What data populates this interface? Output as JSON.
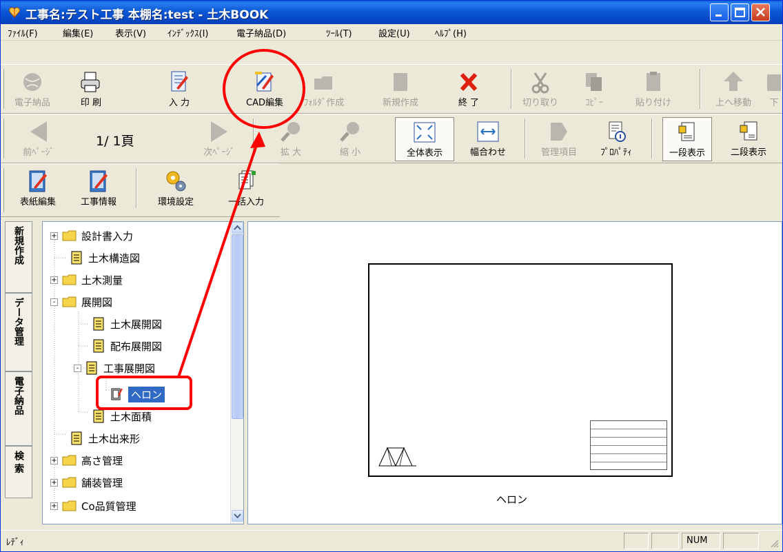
{
  "window": {
    "title": "工事名:テスト工事  本棚名:test  - 土木BOOK"
  },
  "menu": [
    "ﾌｧｲﾙ(F)",
    "編集(E)",
    "表示(V)",
    "ｲﾝﾃﾞｯｸｽ(I)",
    "電子納品(D)",
    "ﾂｰﾙ(T)",
    "設定(U)",
    "ﾍﾙﾌﾟ(H)"
  ],
  "toolbar1": [
    {
      "label": "電子納品",
      "icon": "globe-icon",
      "enabled": false
    },
    {
      "label": "印 刷",
      "icon": "printer-icon",
      "enabled": true
    },
    {
      "label": "入 力",
      "icon": "input-icon",
      "enabled": true
    },
    {
      "label": "CAD編集",
      "icon": "cad-edit-icon",
      "enabled": true
    },
    {
      "label": "ﾌｫﾙﾀﾞ作成",
      "icon": "folder-create-icon",
      "enabled": false
    },
    {
      "label": "新規作成",
      "icon": "new-doc-icon",
      "enabled": false
    },
    {
      "label": "終 了",
      "icon": "close-x-icon",
      "enabled": true
    },
    {
      "label": "切り取り",
      "icon": "scissors-icon",
      "enabled": false
    },
    {
      "label": "ｺﾋﾟｰ",
      "icon": "copy-icon",
      "enabled": false
    },
    {
      "label": "貼り付け",
      "icon": "paste-icon",
      "enabled": false
    },
    {
      "label": "上へ移動",
      "icon": "up-arrow-icon",
      "enabled": false
    },
    {
      "label": "下",
      "icon": "down-arrow-icon",
      "enabled": false
    }
  ],
  "toolbar2": {
    "prev": "前ﾍﾟｰｼﾞ",
    "page": "1/  1頁",
    "next": "次ﾍﾟｰｼﾞ",
    "zoom_in": "拡 大",
    "zoom_out": "縮 小",
    "fit_all": "全体表示",
    "fit_width": "幅合わせ",
    "manage": "管理項目",
    "properties": "ﾌﾟﾛﾊﾟﾃｨ",
    "one_col": "一段表示",
    "two_col": "二段表示"
  },
  "toolbar3": {
    "cover_edit": "表紙編集",
    "project_info": "工事情報",
    "env_settings": "環境設定",
    "batch_input": "一括入力"
  },
  "side_tabs": [
    "新規作成",
    "データ管理",
    "電子納品",
    "検 索"
  ],
  "tree": {
    "items": [
      {
        "label": "設計書入力",
        "type": "folder",
        "expander": "+"
      },
      {
        "label": "土木構造図",
        "type": "doc"
      },
      {
        "label": "土木測量",
        "type": "folder",
        "expander": "+"
      },
      {
        "label": "展開図",
        "type": "folder",
        "expander": "-"
      },
      {
        "label": "土木展開図",
        "type": "doc"
      },
      {
        "label": "配布展開図",
        "type": "doc"
      },
      {
        "label": "工事展開図",
        "type": "doc",
        "expander": "-"
      },
      {
        "label": "ヘロン",
        "type": "cad",
        "selected": true
      },
      {
        "label": "土木面積",
        "type": "doc"
      },
      {
        "label": "土木出来形",
        "type": "doc"
      },
      {
        "label": "高さ管理",
        "type": "folder",
        "expander": "+"
      },
      {
        "label": "舗装管理",
        "type": "folder",
        "expander": "+"
      },
      {
        "label": "Co品質管理",
        "type": "folder",
        "expander": "+"
      }
    ]
  },
  "preview": {
    "caption": "ヘロン"
  },
  "status": {
    "text": "ﾚﾃﾞｨ",
    "num": "NUM"
  },
  "colors": {
    "titlebar": "#0b58d6",
    "selection": "#316ac5",
    "annotation": "#ff0000"
  }
}
